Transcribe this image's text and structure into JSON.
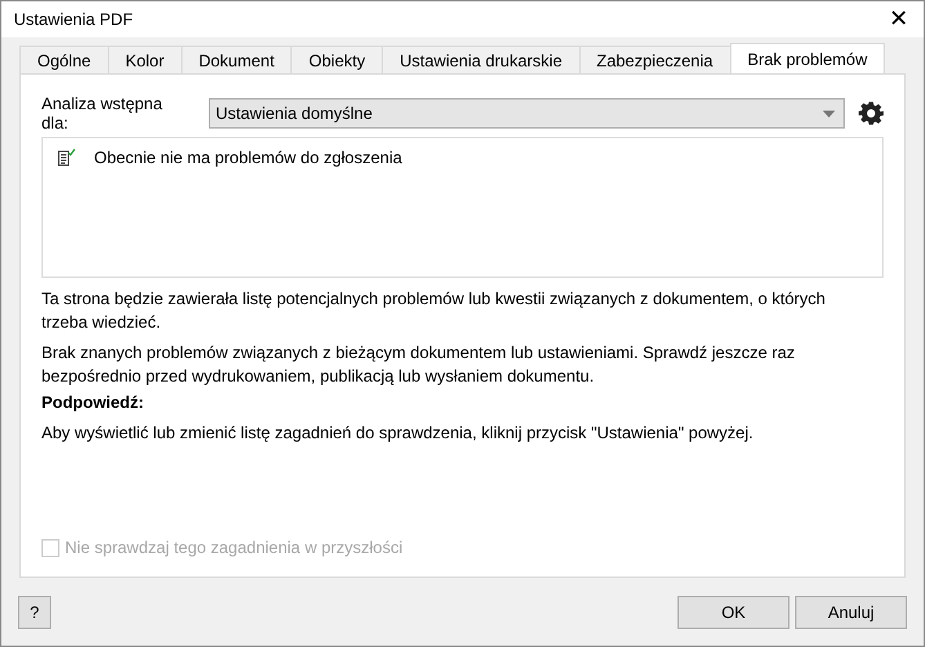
{
  "window": {
    "title": "Ustawienia PDF",
    "close": "✕"
  },
  "tabs": [
    {
      "label": "Ogólne",
      "selected": false
    },
    {
      "label": "Kolor",
      "selected": false
    },
    {
      "label": "Dokument",
      "selected": false
    },
    {
      "label": "Obiekty",
      "selected": false
    },
    {
      "label": "Ustawienia drukarskie",
      "selected": false
    },
    {
      "label": "Zabezpieczenia",
      "selected": false
    },
    {
      "label": "Brak problemów",
      "selected": true
    }
  ],
  "preflight": {
    "label": "Analiza wstępna dla:",
    "value": "Ustawienia domyślne"
  },
  "issues": [
    {
      "text": "Obecnie nie ma problemów do zgłoszenia"
    }
  ],
  "paragraphs": [
    {
      "kind": "text",
      "text": "Ta strona będzie zawierała listę potencjalnych problemów lub kwestii związanych z dokumentem, o których trzeba wiedzieć."
    },
    {
      "kind": "text",
      "text": "Brak znanych problemów związanych z bieżącym dokumentem lub ustawieniami. Sprawdź jeszcze raz bezpośrednio przed wydrukowaniem, publikacją lub wysłaniem dokumentu."
    },
    {
      "kind": "heading",
      "text": "Podpowiedź:"
    },
    {
      "kind": "text",
      "text": "Aby wyświetlić lub zmienić listę zagadnień do sprawdzenia, kliknij przycisk \"Ustawienia\" powyżej."
    }
  ],
  "ignore": {
    "label": "Nie sprawdzaj tego zagadnienia w przyszłości",
    "checked": false,
    "disabled": true
  },
  "help": "?",
  "buttons": [
    "OK",
    "Anuluj"
  ]
}
